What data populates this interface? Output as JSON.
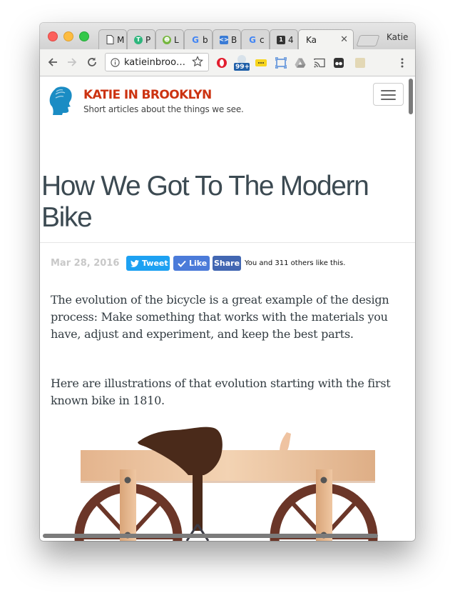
{
  "browser": {
    "tabs": [
      {
        "label": "M",
        "icon": "document-icon"
      },
      {
        "label": "P",
        "icon": "tree-icon"
      },
      {
        "label": "L",
        "icon": "frog-icon"
      },
      {
        "label": "b",
        "icon": "google-icon"
      },
      {
        "label": "B",
        "icon": "brackets-icon"
      },
      {
        "label": "c",
        "icon": "google-icon"
      },
      {
        "label": "4",
        "icon": "number-one-icon"
      },
      {
        "label": "Ka",
        "icon": "page-icon"
      }
    ],
    "close_symbol": "✕",
    "profile_name": "Katie",
    "url": "katieinbroo…",
    "badge_count": "99+",
    "colors": {
      "accent_red": "#cc3311",
      "twitter": "#1da1f2",
      "facebook": "#4267b2"
    }
  },
  "site": {
    "title": "KATIE IN BROOKLYN",
    "tagline": "Short articles about the things we see."
  },
  "article": {
    "title": "How We Got To The Modern Bike",
    "date": "Mar 28, 2016",
    "tweet_label": "Tweet",
    "like_label": "Like",
    "share_label": "Share",
    "share_count_text": "You and 311 others like this.",
    "paragraphs": [
      "The evolution of the bicycle is a great example of the design process: Make something that works with the materials you have, adjust and experiment, and keep the best parts.",
      "Here are illustrations of that evolution starting with the first known bike in 1810."
    ]
  }
}
